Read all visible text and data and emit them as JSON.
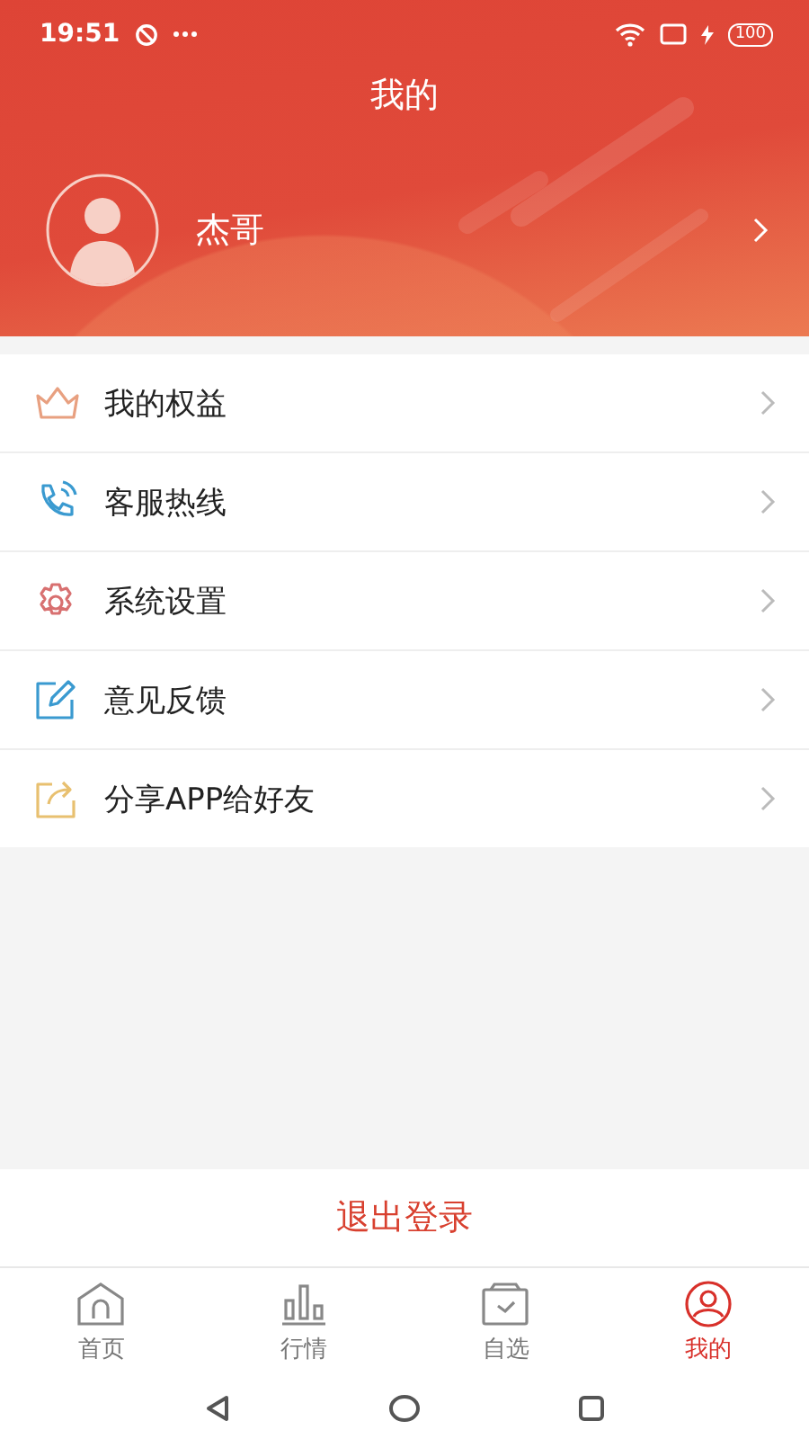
{
  "status_bar": {
    "time": "19:51",
    "battery": "100"
  },
  "header": {
    "title": "我的",
    "user_name": "杰哥"
  },
  "menu": [
    {
      "kind": "crown",
      "label": "我的权益",
      "color": "#e8a080"
    },
    {
      "kind": "phone",
      "label": "客服热线",
      "color": "#3a9ad0"
    },
    {
      "kind": "gear",
      "label": "系统设置",
      "color": "#d87070"
    },
    {
      "kind": "edit",
      "label": "意见反馈",
      "color": "#3a9ad0"
    },
    {
      "kind": "share",
      "label": "分享APP给好友",
      "color": "#e8c070"
    }
  ],
  "logout": "退出登录",
  "tabs": [
    {
      "kind": "home",
      "label": "首页",
      "selected": false
    },
    {
      "kind": "chart",
      "label": "行情",
      "selected": false
    },
    {
      "kind": "box",
      "label": "自选",
      "selected": false
    },
    {
      "kind": "user",
      "label": "我的",
      "selected": true
    }
  ]
}
